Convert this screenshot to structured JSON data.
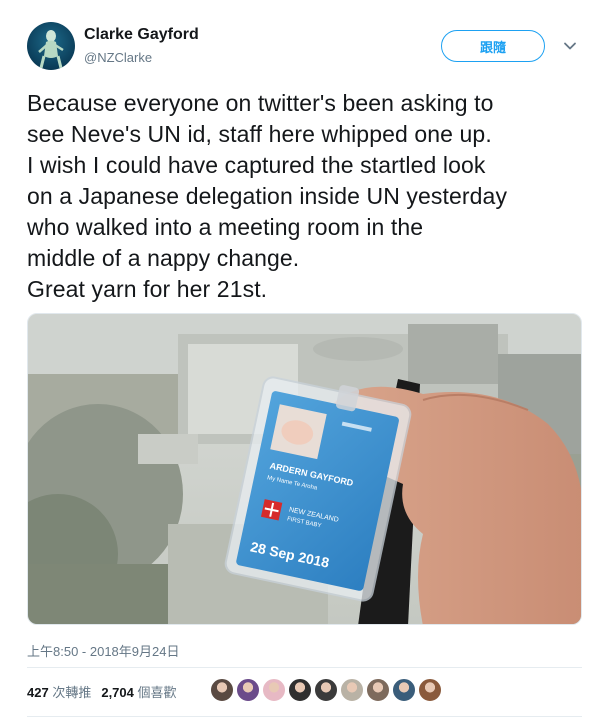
{
  "user": {
    "name": "Clarke Gayford",
    "handle": "@NZClarke"
  },
  "follow_button_label": "跟隨",
  "tweet": {
    "lines": [
      "Because everyone on twitter's been asking to",
      "see Neve's UN id, staff here whipped one up.",
      "I wish I could have captured the startled look",
      "on a Japanese delegation inside UN yesterday",
      "who walked into a meeting room in the",
      "middle of a nappy change.",
      "Great yarn for her 21st."
    ]
  },
  "badge": {
    "name": "ARDERN GAYFORD",
    "subname": "My Name Te Aroha",
    "country": "NEW ZEALAND",
    "role": "FIRST BABY",
    "date": "28 Sep 2018"
  },
  "timestamp": "上午8:50 - 2018年9月24日",
  "stats": {
    "retweets_count": "427",
    "retweets_label": "次轉推",
    "likes_count": "2,704",
    "likes_label": "個喜歡"
  },
  "likers": [
    {
      "color": "#5a4a42"
    },
    {
      "color": "#6b4b8a"
    },
    {
      "color": "#e7b9c4"
    },
    {
      "color": "#2f2f2f"
    },
    {
      "color": "#3b3b3b"
    },
    {
      "color": "#b9b2a5"
    },
    {
      "color": "#7d6a5c"
    },
    {
      "color": "#3a5d7a"
    },
    {
      "color": "#8a5a3c"
    }
  ]
}
